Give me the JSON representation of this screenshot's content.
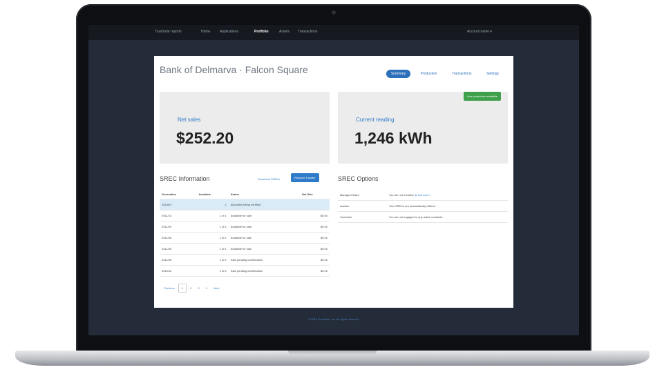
{
  "topnav": {
    "items": [
      "TrueSolar reports",
      "Home",
      "Applications",
      "Portfolio",
      "Assets",
      "Transactions"
    ],
    "active_index": 3,
    "account": "Account name ▾"
  },
  "page": {
    "title": "Bank of Delmarva · Falcon Square",
    "tabs": [
      "Summary",
      "Production",
      "Transactions",
      "Settings"
    ],
    "active_tab": 0
  },
  "cards": {
    "left": {
      "label": "Net sales",
      "value": "$252.20"
    },
    "right": {
      "label": "Current reading",
      "value": "1,246 kWh",
      "badge": "Live production available"
    }
  },
  "spec_info": {
    "title": "SREC Information",
    "link": "Download SRECs",
    "button": "Request Transfer",
    "columns": [
      "Generation",
      "Available",
      "Status",
      "Net Sale"
    ],
    "rows": [
      [
        "2013/01",
        "1",
        "Allocation being certified",
        ""
      ],
      [
        "2011/10",
        "1 of 1",
        "Available for sale",
        "$0.00"
      ],
      [
        "2011/09",
        "1 of 1",
        "Available for sale",
        "$0.00"
      ],
      [
        "2011/08",
        "1 of 1",
        "Available for sale",
        "$0.00"
      ],
      [
        "2011/06",
        "1 of 1",
        "Available for sale",
        "$0.00"
      ],
      [
        "2011/05",
        "1 of 1",
        "Sale pending confirmation",
        "$0.00"
      ],
      [
        "2010/12",
        "1 of 2",
        "Sale pending confirmation",
        "$0.00"
      ]
    ],
    "pager": [
      "Previous",
      "1",
      "2",
      "3",
      "4",
      "Next"
    ],
    "pager_current": 1
  },
  "spec_options": {
    "title": "SREC Options",
    "rows": [
      {
        "label": "Managed Sales",
        "value": "You are not enrolled.",
        "link": "Enroll now »"
      },
      {
        "label": "Auction",
        "value": "Your SRECs are automatically offered",
        "link": ""
      },
      {
        "label": "Contracts",
        "value": "You are not engaged in any active contracts",
        "link": ""
      }
    ]
  },
  "footer": {
    "text": "© 2013 TrueSolar, Inc. All rights reserved."
  },
  "colors": {
    "accent": "#2c6fba",
    "badge_green": "#3ea04a",
    "screen_bg": "#242c39"
  }
}
